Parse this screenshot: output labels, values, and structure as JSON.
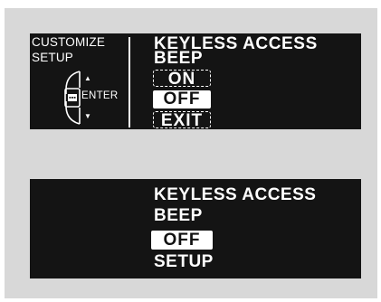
{
  "top_panel": {
    "side_title_line1": "CUSTOMIZE",
    "side_title_line2": "SETUP",
    "enter_label": "ENTER",
    "up_arrow": "▲",
    "down_arrow": "▼",
    "menu_title_line1": "KEYLESS ACCESS",
    "menu_title_line2": "BEEP",
    "options": [
      {
        "label": "ON",
        "state": "dashed"
      },
      {
        "label": "OFF",
        "state": "selected"
      },
      {
        "label": "EXIT",
        "state": "dashed"
      }
    ]
  },
  "bottom_panel": {
    "title_line1": "KEYLESS ACCESS",
    "title_line2": "BEEP",
    "value": "OFF",
    "footer": "SETUP"
  },
  "colors": {
    "background": "#d8d8d8",
    "panel": "#141414",
    "text": "#ffffff",
    "highlight": "#ffffff"
  }
}
